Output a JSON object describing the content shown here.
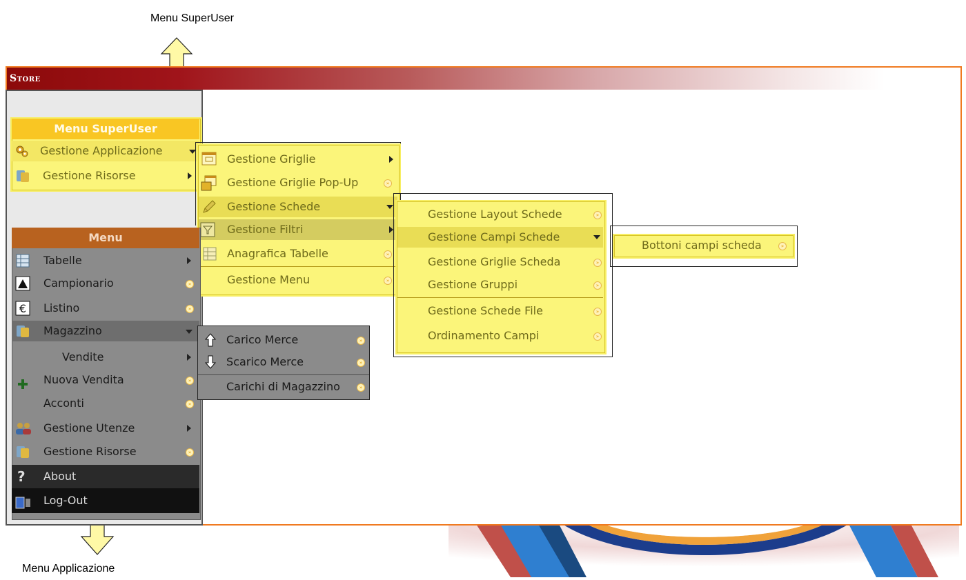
{
  "callouts": {
    "top": "Menu SuperUser",
    "bottom": "Menu Applicazione"
  },
  "app": {
    "title": "Store"
  },
  "superuser_menu": {
    "header": "Menu SuperUser",
    "items": [
      {
        "label": "Gestione Applicazione",
        "icon": "gears-icon",
        "indicator": "chevron-down"
      },
      {
        "label": "Gestione Risorse",
        "icon": "resources-icon",
        "indicator": "chevron-right"
      }
    ]
  },
  "applicazione_submenu": {
    "items": [
      {
        "label": "Gestione Griglie",
        "icon": "grid-icon",
        "indicator": "chevron-right"
      },
      {
        "label": "Gestione Griglie Pop-Up",
        "icon": "popup-grid-icon",
        "indicator": "go"
      },
      {
        "label": "Gestione Schede",
        "icon": "pencil-icon",
        "indicator": "chevron-down"
      },
      {
        "label": "Gestione Filtri",
        "icon": "filter-icon",
        "indicator": "chevron-right"
      },
      {
        "label": "Anagrafica Tabelle",
        "icon": "table-icon",
        "indicator": "go"
      },
      {
        "label": "Gestione Menu",
        "icon": "",
        "indicator": "go"
      }
    ]
  },
  "schede_submenu": {
    "items": [
      {
        "label": "Gestione Layout Schede",
        "indicator": "go"
      },
      {
        "label": "Gestione Campi Schede",
        "indicator": "chevron-down"
      },
      {
        "label": "Gestione Griglie Scheda",
        "indicator": "go"
      },
      {
        "label": "Gestione Gruppi",
        "indicator": "go"
      },
      {
        "label": "Gestione Schede File",
        "indicator": "go"
      },
      {
        "label": "Ordinamento Campi",
        "indicator": "go"
      }
    ]
  },
  "campi_submenu": {
    "items": [
      {
        "label": "Bottoni campi scheda",
        "indicator": "go"
      }
    ]
  },
  "main_menu": {
    "header": "Menu",
    "items": [
      {
        "label": "Tabelle",
        "icon": "table-icon",
        "indicator": "chevron-right"
      },
      {
        "label": "Campionario",
        "icon": "campionario-icon",
        "indicator": "go"
      },
      {
        "label": "Listino",
        "icon": "euro-icon",
        "indicator": "go"
      },
      {
        "label": "Magazzino",
        "icon": "resources-icon",
        "indicator": "chevron-down"
      },
      {
        "label": "Vendite",
        "icon": "",
        "indicator": "chevron-right"
      },
      {
        "label": "Nuova Vendita",
        "icon": "plus-icon",
        "indicator": "go"
      },
      {
        "label": "Acconti",
        "icon": "",
        "indicator": "go"
      },
      {
        "label": "Gestione Utenze",
        "icon": "users-icon",
        "indicator": "chevron-right"
      },
      {
        "label": "Gestione Risorse",
        "icon": "resources-icon",
        "indicator": "go"
      },
      {
        "label": "About",
        "icon": "question-icon",
        "indicator": ""
      },
      {
        "label": "Log-Out",
        "icon": "logout-icon",
        "indicator": ""
      }
    ]
  },
  "magazzino_submenu": {
    "items": [
      {
        "label": "Carico Merce",
        "icon": "arrow-up-icon",
        "indicator": "go"
      },
      {
        "label": "Scarico Merce",
        "icon": "arrow-down-icon",
        "indicator": "go"
      },
      {
        "label": "Carichi di Magazzino",
        "icon": "",
        "indicator": "go"
      }
    ]
  },
  "colors": {
    "frame": "#f07a20",
    "title_start": "#8c0a0a",
    "highlight": "#fbf57a",
    "superuser_header": "#f9c623",
    "menu_header": "#b8621f",
    "menu_bg": "#8b8b8b"
  }
}
